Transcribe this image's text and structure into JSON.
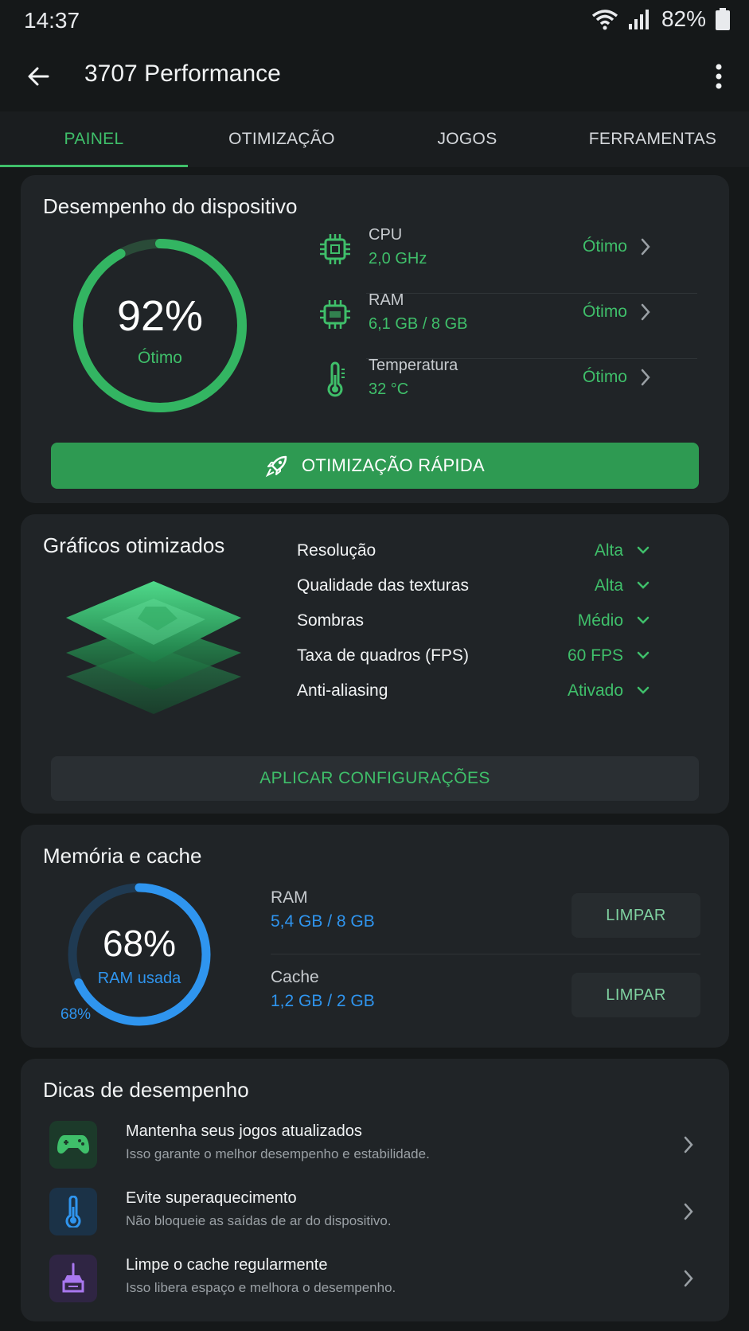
{
  "status_bar": {
    "time": "14:37",
    "battery": "82%"
  },
  "app_bar": {
    "title": "3707 Performance"
  },
  "tabs": [
    {
      "label": "PAINEL",
      "active": true
    },
    {
      "label": "OTIMIZAÇÃO",
      "active": false
    },
    {
      "label": "JOGOS",
      "active": false
    },
    {
      "label": "FERRAMENTAS",
      "active": false
    }
  ],
  "performance": {
    "title": "Desempenho do dispositivo",
    "score": "92%",
    "score_fraction": 0.92,
    "score_label": "Ótimo",
    "metrics": [
      {
        "name": "CPU",
        "value": "2,0 GHz",
        "status": "Ótimo",
        "icon": "cpu-icon"
      },
      {
        "name": "RAM",
        "value": "6,1 GB / 8 GB",
        "status": "Ótimo",
        "icon": "ram-chip-icon"
      },
      {
        "name": "Temperatura",
        "value": "32 °C",
        "status": "Ótimo",
        "icon": "thermometer-icon"
      }
    ],
    "quick_button": "OTIMIZAÇÃO RÁPIDA"
  },
  "graphics": {
    "title": "Gráficos otimizados",
    "settings": [
      {
        "name": "Resolução",
        "value": "Alta"
      },
      {
        "name": "Qualidade das texturas",
        "value": "Alta"
      },
      {
        "name": "Sombras",
        "value": "Médio"
      },
      {
        "name": "Taxa de quadros (FPS)",
        "value": "60 FPS"
      },
      {
        "name": "Anti-aliasing",
        "value": "Ativado"
      }
    ],
    "apply_button": "APLICAR CONFIGURAÇÕES"
  },
  "memory": {
    "title": "Memória e cache",
    "gauge_value": "68%",
    "gauge_fraction": 0.68,
    "gauge_label": "RAM usada",
    "gauge_small": "68%",
    "rows": [
      {
        "name": "RAM",
        "value": "5,4 GB / 8 GB",
        "button": "LIMPAR"
      },
      {
        "name": "Cache",
        "value": "1,2 GB / 2 GB",
        "button": "LIMPAR"
      }
    ]
  },
  "tips": {
    "title": "Dicas de desempenho",
    "items": [
      {
        "title": "Mantenha seus jogos atualizados",
        "subtitle": "Isso garante o melhor desempenho e estabilidade.",
        "icon": "gamepad-icon"
      },
      {
        "title": "Evite superaquecimento",
        "subtitle": "Não bloqueie as saídas de ar do dispositivo.",
        "icon": "thermometer-icon"
      },
      {
        "title": "Limpe o cache regularmente",
        "subtitle": "Isso libera espaço e melhora o desempenho.",
        "icon": "broom-icon"
      }
    ]
  },
  "colors": {
    "accent_green": "#3fbf6a",
    "accent_blue": "#2f95ef",
    "card_bg": "#202427",
    "page_bg": "#151819"
  }
}
